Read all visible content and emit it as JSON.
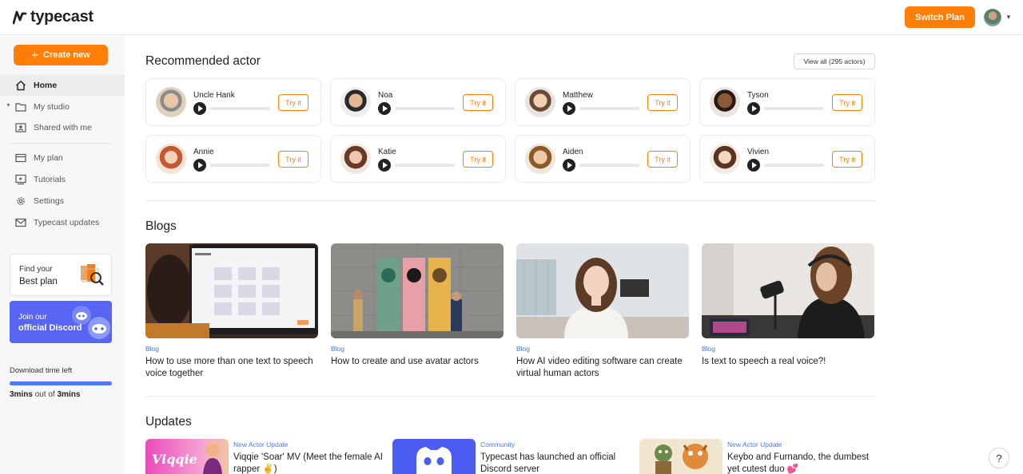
{
  "header": {
    "logo_text": "typecast",
    "switch_plan_label": "Switch Plan"
  },
  "sidebar": {
    "create_label": "Create new",
    "items": [
      {
        "label": "Home",
        "icon": "home-icon",
        "active": true
      },
      {
        "label": "My studio",
        "icon": "folder-icon"
      },
      {
        "label": "Shared with me",
        "icon": "shared-icon"
      },
      {
        "label": "My plan",
        "icon": "card-icon"
      },
      {
        "label": "Tutorials",
        "icon": "video-icon"
      },
      {
        "label": "Settings",
        "icon": "gear-icon"
      },
      {
        "label": "Typecast updates",
        "icon": "mail-icon"
      }
    ],
    "promo_plan": {
      "line1": "Find your",
      "line2": "Best plan"
    },
    "promo_discord": {
      "line1": "Join our",
      "line2": "official Discord"
    },
    "download": {
      "label": "Download time left",
      "used_fraction": 1.0,
      "amount": "3mins",
      "out_of": "out of",
      "total": "3mins"
    }
  },
  "recommended": {
    "title": "Recommended actor",
    "view_all_label": "View all (295 actors)",
    "try_label": "Try it",
    "actors": [
      {
        "name": "Uncle Hank"
      },
      {
        "name": "Noa"
      },
      {
        "name": "Matthew"
      },
      {
        "name": "Tyson"
      },
      {
        "name": "Annie"
      },
      {
        "name": "Katie"
      },
      {
        "name": "Aiden"
      },
      {
        "name": "Vivien"
      }
    ]
  },
  "blogs": {
    "title": "Blogs",
    "items": [
      {
        "tag": "Blog",
        "title": "How to use more than one text to speech voice together"
      },
      {
        "tag": "Blog",
        "title": "How to create and use avatar actors"
      },
      {
        "tag": "Blog",
        "title": "How AI video editing software can create virtual human actors"
      },
      {
        "tag": "Blog",
        "title": "Is text to speech a real voice?!"
      }
    ]
  },
  "updates": {
    "title": "Updates",
    "items": [
      {
        "tag": "New Actor Update",
        "title": "Viqqie 'Soar' MV (Meet the female AI rapper ✌️)",
        "thumb_text": "Viqqie"
      },
      {
        "tag": "Community",
        "title": "Typecast has launched an official Discord server"
      },
      {
        "tag": "New Actor Update",
        "title": "Keybo and Furnando, the dumbest yet cutest duo 💕"
      }
    ]
  },
  "help_label": "?",
  "colors": {
    "accent": "#ff7e0a",
    "link": "#4a7bf0",
    "discord": "#5865f2"
  }
}
